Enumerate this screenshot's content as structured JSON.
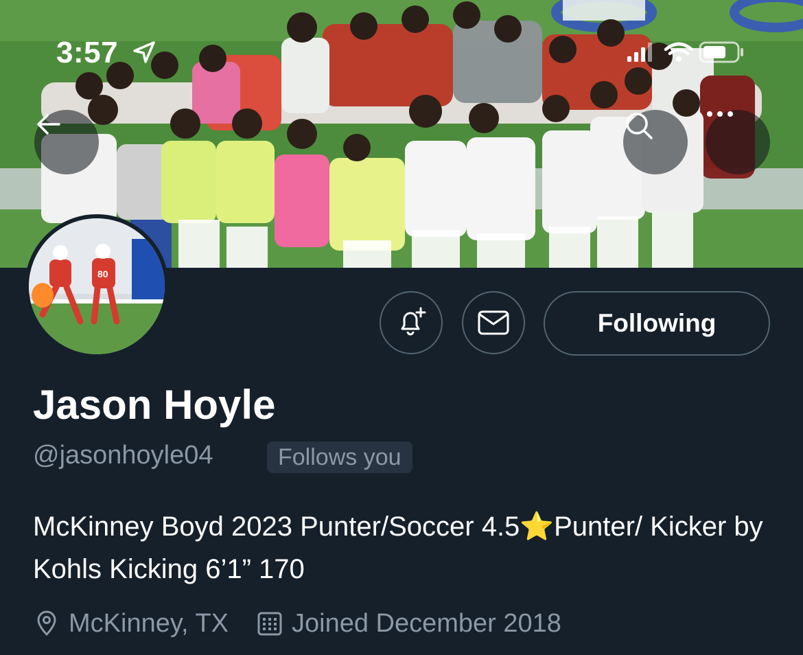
{
  "status_bar": {
    "time": "3:57"
  },
  "header": {
    "back_icon": "arrow-left-icon",
    "search_icon": "search-icon",
    "more_icon": "more-horizontal-icon"
  },
  "profile": {
    "name": "Jason Hoyle",
    "handle": "@jasonhoyle04",
    "follows_you": "Follows you",
    "bio": "McKinney Boyd 2023 Punter/Soccer 4.5⭐️Punter/ Kicker by Kohls Kicking 6’1” 170",
    "location": "McKinney, TX",
    "joined": "Joined December 2018"
  },
  "actions": {
    "notify_icon": "bell-plus-icon",
    "message_icon": "envelope-icon",
    "following_label": "Following"
  },
  "colors": {
    "background": "#15202b",
    "muted_text": "#8b98a5",
    "border": "#536471",
    "badge_bg": "#273340"
  }
}
